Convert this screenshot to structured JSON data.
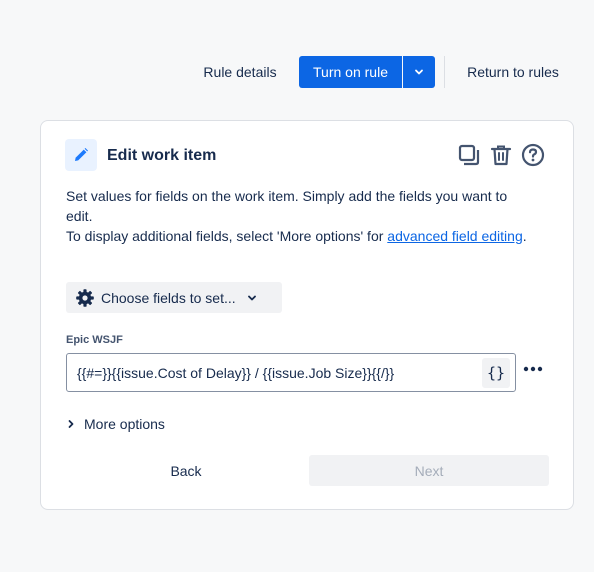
{
  "topbar": {
    "rule_details": "Rule details",
    "turn_on_rule": "Turn on rule",
    "return_to_rules": "Return to rules"
  },
  "card": {
    "title": "Edit work item",
    "description_line1": "Set values for fields on the work item. Simply add the fields you want to edit.",
    "description_line2_prefix": "To display additional fields, select 'More options' for ",
    "description_link": "advanced field editing",
    "description_line2_suffix": ".",
    "choose_fields_label": "Choose fields to set...",
    "field": {
      "label": "Epic WSJF",
      "value": "{{#=}}{{issue.Cost of Delay}} / {{issue.Job Size}}{{/}}",
      "smart_value_button": "{}"
    },
    "more_options": "More options",
    "back_label": "Back",
    "next_label": "Next"
  },
  "colors": {
    "primary": "#0c66e4",
    "icon_bg": "#e9f2ff",
    "text": "#172b4d",
    "disabled_text": "#a5adba"
  },
  "icons": {
    "header": "pencil-icon",
    "copy": "copy-icon",
    "delete": "trash-icon",
    "help": "question-icon",
    "settings": "gear-icon"
  }
}
